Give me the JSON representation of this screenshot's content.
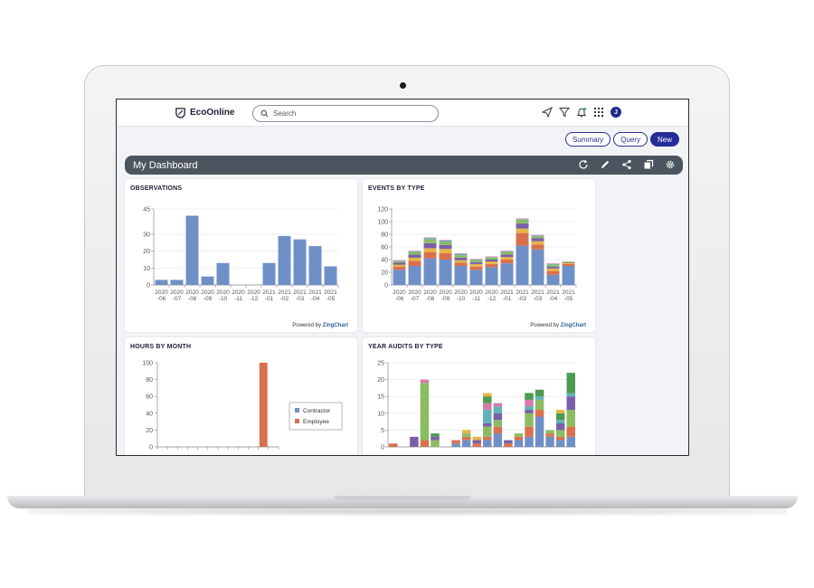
{
  "app": {
    "logo_text": "EcoOnline",
    "search_placeholder": "Search",
    "avatar_initial": "J"
  },
  "actions": {
    "summary": "Summary",
    "query": "Query",
    "new": "New"
  },
  "dashboard": {
    "title": "My Dashboard"
  },
  "widgets": {
    "observations": {
      "title": "OBSERVATIONS",
      "powered_prefix": "Powered by ",
      "powered_brand": "ZingChart"
    },
    "events": {
      "title": "EVENTS BY TYPE",
      "powered_prefix": "Powered by ",
      "powered_brand": "ZingChart"
    },
    "hours": {
      "title": "HOURS BY MONTH"
    },
    "audits": {
      "title": "YEAR AUDITS BY TYPE"
    }
  },
  "colors": {
    "blue": "#6f8fc7",
    "orange": "#d9704d",
    "green": "#8bbb62",
    "purple": "#7a5fa8",
    "teal": "#5fb3b8",
    "pink": "#d67ca8",
    "dgreen": "#4e9a53",
    "yellow": "#e6b547",
    "red": "#c94d45"
  },
  "chart_data": [
    {
      "id": "observations",
      "type": "bar",
      "categories": [
        [
          "2020",
          "-06"
        ],
        [
          "2020",
          "-07"
        ],
        [
          "2020",
          "-08"
        ],
        [
          "2020",
          "-09"
        ],
        [
          "2020",
          "-10"
        ],
        [
          "2020",
          "-11"
        ],
        [
          "2020",
          "-12"
        ],
        [
          "2021",
          "-01"
        ],
        [
          "2021",
          "-02"
        ],
        [
          "2021",
          "-03"
        ],
        [
          "2021",
          "-04"
        ],
        [
          "2021",
          "-05"
        ]
      ],
      "values": [
        3,
        3,
        41,
        5,
        13,
        0,
        0,
        13,
        29,
        27,
        23,
        11
      ],
      "ylim": [
        0,
        45
      ],
      "yticks": [
        0,
        10,
        20,
        30,
        45
      ],
      "grid": true
    },
    {
      "id": "events",
      "type": "stacked-bar",
      "categories": [
        [
          "2020",
          "-06"
        ],
        [
          "2020",
          "-07"
        ],
        [
          "2020",
          "-08"
        ],
        [
          "2020",
          "-09"
        ],
        [
          "2020",
          "-10"
        ],
        [
          "2020",
          "-11"
        ],
        [
          "2020",
          "-12"
        ],
        [
          "2021",
          "-01"
        ],
        [
          "2021",
          "-02"
        ],
        [
          "2021",
          "-03"
        ],
        [
          "2021",
          "-04"
        ],
        [
          "2021",
          "-05"
        ]
      ],
      "series_colors": [
        "blue",
        "orange",
        "yellow",
        "purple",
        "green",
        "teal",
        "pink"
      ],
      "stacks": [
        [
          24,
          5,
          3,
          3,
          2,
          1,
          1
        ],
        [
          30,
          8,
          5,
          5,
          4,
          1,
          1
        ],
        [
          42,
          10,
          6,
          8,
          6,
          2,
          1
        ],
        [
          40,
          10,
          7,
          6,
          5,
          2,
          1
        ],
        [
          30,
          5,
          4,
          4,
          4,
          2,
          1
        ],
        [
          24,
          5,
          4,
          3,
          3,
          1,
          1
        ],
        [
          28,
          5,
          4,
          3,
          3,
          1,
          1
        ],
        [
          34,
          6,
          4,
          4,
          4,
          1,
          1
        ],
        [
          62,
          20,
          7,
          8,
          6,
          1,
          1
        ],
        [
          56,
          8,
          5,
          5,
          3,
          1,
          1
        ],
        [
          16,
          6,
          4,
          3,
          3,
          1,
          1
        ],
        [
          30,
          3,
          2,
          1,
          1,
          0,
          0
        ]
      ],
      "ylim": [
        0,
        120
      ],
      "yticks": [
        0,
        20,
        40,
        60,
        80,
        100,
        120
      ],
      "grid": true
    },
    {
      "id": "hours",
      "type": "bar",
      "values": [
        0,
        0,
        0,
        0,
        0,
        0,
        0,
        0,
        0,
        0,
        100,
        0
      ],
      "series": [
        {
          "name": "Contractor",
          "color": "blue"
        },
        {
          "name": "Employee",
          "color": "orange"
        }
      ],
      "ylim": [
        0,
        100
      ],
      "yticks": [
        0,
        20,
        40,
        60,
        80,
        100
      ],
      "legend": "right"
    },
    {
      "id": "audits",
      "type": "stacked-bar",
      "series_colors": [
        "blue",
        "orange",
        "green",
        "purple",
        "teal",
        "pink",
        "dgreen",
        "yellow",
        "red"
      ],
      "stacks": [
        [
          0,
          1,
          0,
          0,
          0,
          0,
          0,
          0,
          0
        ],
        [
          0,
          0,
          0,
          0,
          0,
          0,
          0,
          0,
          0
        ],
        [
          0,
          0,
          0,
          3,
          0,
          0,
          0,
          0,
          0
        ],
        [
          0,
          2,
          17,
          0,
          0,
          1,
          0,
          0,
          0
        ],
        [
          0,
          0,
          2,
          1,
          0,
          0,
          1,
          0,
          0
        ],
        [
          0,
          0,
          0,
          0,
          0,
          0,
          0,
          0,
          0
        ],
        [
          1,
          1,
          0,
          0,
          0,
          0,
          0,
          0,
          0
        ],
        [
          2,
          1,
          1,
          0,
          0,
          0,
          0,
          1,
          0
        ],
        [
          0,
          1,
          0,
          1,
          0,
          0,
          0,
          1,
          0
        ],
        [
          2,
          1,
          3,
          1,
          4,
          2,
          2,
          1,
          0
        ],
        [
          4,
          2,
          2,
          2,
          2,
          1,
          0,
          0,
          0
        ],
        [
          0,
          1,
          0,
          1,
          0,
          0,
          0,
          0,
          0
        ],
        [
          2,
          1,
          1,
          0,
          0,
          0,
          0,
          0,
          0
        ],
        [
          3,
          3,
          4,
          1,
          1,
          2,
          2,
          0,
          0
        ],
        [
          9,
          2,
          3,
          0,
          1,
          0,
          2,
          0,
          0
        ],
        [
          3,
          1,
          1,
          0,
          0,
          0,
          0,
          0,
          0
        ],
        [
          2,
          1,
          2,
          2,
          1,
          0,
          2,
          1,
          0
        ],
        [
          3,
          3,
          5,
          4,
          1,
          0,
          6,
          0,
          0
        ]
      ],
      "ylim": [
        0,
        25
      ],
      "yticks": [
        0,
        5,
        10,
        15,
        20,
        25
      ],
      "grid": true
    }
  ]
}
